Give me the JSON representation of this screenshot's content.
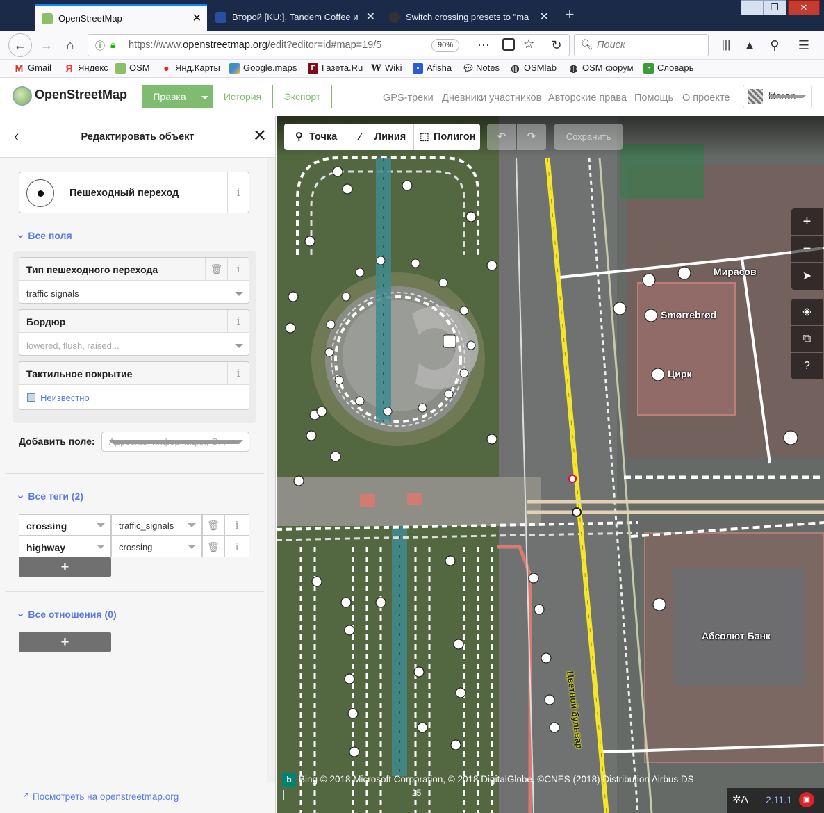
{
  "browser": {
    "tabs": [
      {
        "title": "OpenStreetMap",
        "active": true
      },
      {
        "title": "Второй [KU:], Tandem Coffee и",
        "active": false
      },
      {
        "title": "Switch crossing presets to \"ma",
        "active": false
      }
    ],
    "new_tab_symbol": "+",
    "window_controls": [
      "—",
      "❐",
      "✕"
    ],
    "url_prefix": "https://www.",
    "url_host": "openstreetmap.org",
    "url_path": "/edit?editor=id#map=19/5",
    "zoom": "90%",
    "search_placeholder": "Поиск",
    "bookmarks": [
      "Gmail",
      "Яндекс",
      "OSM",
      "Янд.Карты",
      "Google.maps",
      "Газета.Ru",
      "Wiki",
      "Afisha",
      "Notes",
      "OSMlab",
      "OSM форум",
      "Словарь"
    ]
  },
  "osm_header": {
    "logo": "OpenStreetMap",
    "edit_label": "Правка",
    "history_label": "История",
    "export_label": "Экспорт",
    "links": [
      "GPS-треки",
      "Дневники участников",
      "Авторские права",
      "Помощь",
      "О проекте"
    ],
    "username": "literan"
  },
  "sidebar": {
    "title": "Редактировать объект",
    "preset_name": "Пешеходный переход",
    "all_fields_label": "Все поля",
    "fields": [
      {
        "label": "Тип пешеходного перехода",
        "value": "traffic signals",
        "placeholder": false
      },
      {
        "label": "Бордюр",
        "value": "lowered, flush, raised...",
        "placeholder": true
      },
      {
        "label": "Тактильное покрытие",
        "value": "Неизвестно",
        "placeholder": false
      }
    ],
    "add_field_label": "Добавить поле:",
    "add_field_placeholder": "Адресная информация, О...",
    "all_tags_label": "Все теги (2)",
    "tags": [
      {
        "key": "crossing",
        "value": "traffic_signals"
      },
      {
        "key": "highway",
        "value": "crossing"
      }
    ],
    "all_relations_label": "Все отношения (0)",
    "add_symbol": "+",
    "info_symbol": "i",
    "view_on_osm": "Посмотреть на openstreetmap.org"
  },
  "map_toolbar": {
    "point": "Точка",
    "line": "Линия",
    "polygon": "Полигон",
    "save": "Сохранить"
  },
  "map_labels": {
    "mirasov": "Мирасов",
    "smorrebrod": "Smørrebrød",
    "circus": "Цирк",
    "bank": "Абсолют Банк",
    "street": "Цветной бульвар"
  },
  "map_footer": {
    "attribution_brand": "Bing",
    "attribution": "© 2018 Microsoft Corporation, © 2018 DigitalGlobe, ©CNES (2018) Distribution Airbus DS",
    "scale": "25",
    "version": "2.11.1"
  },
  "colors": {
    "osm_green": "#7ebc6f",
    "link_blue": "#597be7",
    "road_yellow": "#f6e629",
    "tab_bg": "#1c2a4a"
  }
}
